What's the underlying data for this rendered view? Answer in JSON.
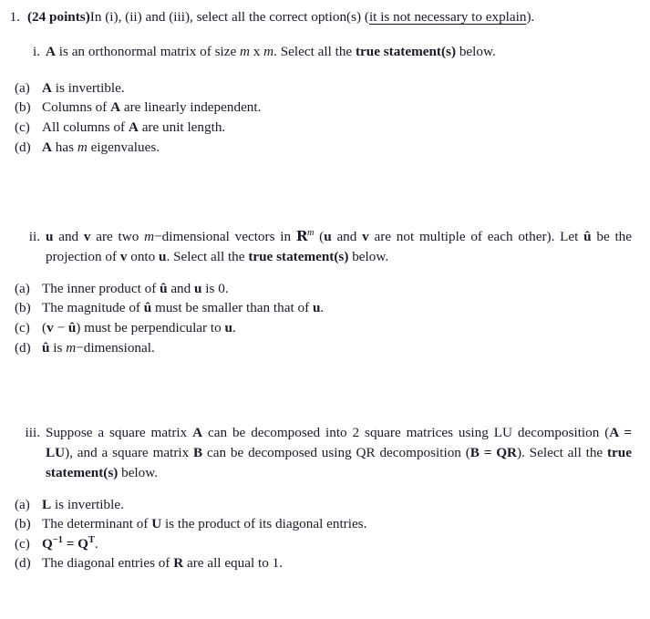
{
  "question": {
    "number": "1.",
    "points_label": "(24 points)",
    "stem_before": "In (i), (ii) and (iii), select all the correct option(s) (",
    "stem_underlined": "it is not necessary to explain",
    "stem_after": ")."
  },
  "subparts": [
    {
      "numeral": "i.",
      "stem": {
        "p1": "A",
        "p2": " is an orthonormal matrix of size ",
        "p3": "m",
        "p4": " x ",
        "p5": "m",
        "p6": ". Select all the ",
        "p7": "true statement(s)",
        "p8": " below."
      },
      "options": [
        {
          "label": "(a)",
          "parts": [
            {
              "t": "A",
              "s": "bf"
            },
            {
              "t": " is invertible.",
              "s": "rm"
            }
          ]
        },
        {
          "label": "(b)",
          "parts": [
            {
              "t": "Columns of ",
              "s": "rm"
            },
            {
              "t": "A",
              "s": "bf"
            },
            {
              "t": " are linearly independent.",
              "s": "rm"
            }
          ]
        },
        {
          "label": "(c)",
          "parts": [
            {
              "t": "All columns of ",
              "s": "rm"
            },
            {
              "t": "A",
              "s": "bf"
            },
            {
              "t": " are unit length.",
              "s": "rm"
            }
          ]
        },
        {
          "label": "(d)",
          "parts": [
            {
              "t": "A",
              "s": "bf"
            },
            {
              "t": " has ",
              "s": "rm"
            },
            {
              "t": "m",
              "s": "it"
            },
            {
              "t": " eigenvalues.",
              "s": "rm"
            }
          ]
        }
      ]
    },
    {
      "numeral": "ii.",
      "stem": {
        "p1": "u",
        "p2": " and ",
        "p3": "v",
        "p4": " are two ",
        "p5": "m",
        "p6": "−dimensional vectors in ",
        "p7": "R",
        "p7sup": "m",
        "p8": " (",
        "p9": "u",
        "p10": " and ",
        "p11": "v",
        "p12": " are not multiple of each other). Let ",
        "p13": "û",
        "p14": " be the projection of ",
        "p15": "v",
        "p16": " onto ",
        "p17": "u",
        "p18": ". Select all the ",
        "p19": "true statement(s)",
        "p20": " below."
      },
      "options": [
        {
          "label": "(a)",
          "parts": [
            {
              "t": "The inner product of ",
              "s": "rm"
            },
            {
              "t": "û",
              "s": "bf"
            },
            {
              "t": " and ",
              "s": "rm"
            },
            {
              "t": "u",
              "s": "bf"
            },
            {
              "t": " is 0.",
              "s": "rm"
            }
          ]
        },
        {
          "label": "(b)",
          "parts": [
            {
              "t": "The magnitude of ",
              "s": "rm"
            },
            {
              "t": "û",
              "s": "bf"
            },
            {
              "t": " must be smaller than that of ",
              "s": "rm"
            },
            {
              "t": "u",
              "s": "bf"
            },
            {
              "t": ".",
              "s": "rm"
            }
          ]
        },
        {
          "label": "(c)",
          "parts": [
            {
              "t": "(",
              "s": "rm"
            },
            {
              "t": "v",
              "s": "bf"
            },
            {
              "t": " − ",
              "s": "rm"
            },
            {
              "t": "û",
              "s": "bf"
            },
            {
              "t": ") must be perpendicular to ",
              "s": "rm"
            },
            {
              "t": "u",
              "s": "bf"
            },
            {
              "t": ".",
              "s": "rm"
            }
          ]
        },
        {
          "label": "(d)",
          "parts": [
            {
              "t": "û",
              "s": "bf"
            },
            {
              "t": " is ",
              "s": "rm"
            },
            {
              "t": "m",
              "s": "it"
            },
            {
              "t": "−dimensional.",
              "s": "rm"
            }
          ]
        }
      ]
    },
    {
      "numeral": "iii.",
      "stem": {
        "p1": "Suppose a square matrix ",
        "p2": "A",
        "p3": " can be decomposed into 2 square matrices using LU decomposition (",
        "p4": "A = LU",
        "p5": "), and a square matrix ",
        "p6": "B",
        "p7": " can be decomposed using QR decomposition (",
        "p8": "B = QR",
        "p9": "). Select all the ",
        "p10": "true statement(s)",
        "p11": " below."
      },
      "options": [
        {
          "label": "(a)",
          "parts": [
            {
              "t": "L",
              "s": "bf"
            },
            {
              "t": " is invertible.",
              "s": "rm"
            }
          ]
        },
        {
          "label": "(b)",
          "parts": [
            {
              "t": "The determinant of ",
              "s": "rm"
            },
            {
              "t": "U",
              "s": "bf"
            },
            {
              "t": " is the product of its diagonal entries.",
              "s": "rm"
            }
          ]
        },
        {
          "label": "(c)",
          "parts": [
            {
              "t": "Q",
              "s": "bf"
            },
            {
              "t": "−1",
              "s": "sup-bf"
            },
            {
              "t": " = ",
              "s": "bf"
            },
            {
              "t": "Q",
              "s": "bf"
            },
            {
              "t": "T",
              "s": "sup-bf"
            },
            {
              "t": ".",
              "s": "rm"
            }
          ]
        },
        {
          "label": "(d)",
          "parts": [
            {
              "t": "The diagonal entries of ",
              "s": "rm"
            },
            {
              "t": "R",
              "s": "bf"
            },
            {
              "t": " are all equal to 1.",
              "s": "rm"
            }
          ]
        }
      ]
    }
  ],
  "colors": {
    "text": "#1a1a28",
    "background": "#ffffff"
  }
}
